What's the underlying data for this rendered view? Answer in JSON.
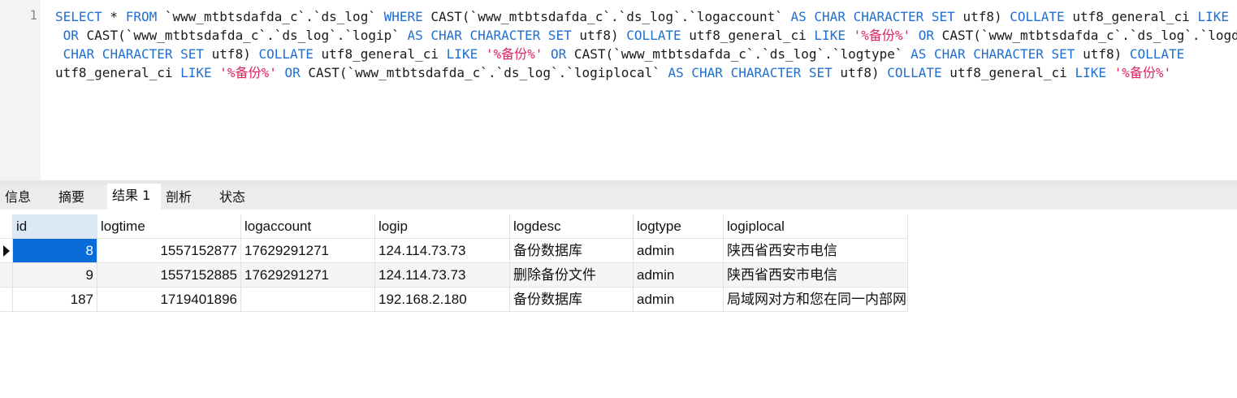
{
  "editor": {
    "line_number": "1",
    "lines": [
      [
        [
          "SELECT",
          "kw"
        ],
        [
          " * ",
          ""
        ],
        [
          "FROM",
          "kw"
        ],
        [
          " `www_mtbtsdafda_c`.`ds_log` ",
          ""
        ],
        [
          "WHERE",
          "kw"
        ],
        [
          " CAST(`www_mtbtsdafda_c`.`ds_log`.`logaccount` ",
          ""
        ],
        [
          "AS CHAR CHARACTER SET",
          "kw"
        ],
        [
          " utf8) ",
          ""
        ],
        [
          "COLLATE",
          "kw"
        ],
        [
          " utf8_general_ci ",
          ""
        ],
        [
          "LIKE",
          "kw"
        ],
        [
          " ",
          ""
        ],
        [
          "'%备份%'",
          "str"
        ]
      ],
      [
        [
          " ",
          ""
        ],
        [
          "OR",
          "kw"
        ],
        [
          " CAST(`www_mtbtsdafda_c`.`ds_log`.`logip` ",
          ""
        ],
        [
          "AS CHAR CHARACTER SET",
          "kw"
        ],
        [
          " utf8) ",
          ""
        ],
        [
          "COLLATE",
          "kw"
        ],
        [
          " utf8_general_ci ",
          ""
        ],
        [
          "LIKE",
          "kw"
        ],
        [
          " ",
          ""
        ],
        [
          "'%备份%'",
          "str"
        ],
        [
          " ",
          ""
        ],
        [
          "OR",
          "kw"
        ],
        [
          " CAST(`www_mtbtsdafda_c`.`ds_log`.`logdesc` ",
          ""
        ],
        [
          "AS",
          "kw"
        ]
      ],
      [
        [
          " ",
          ""
        ],
        [
          "CHAR CHARACTER SET",
          "kw"
        ],
        [
          " utf8) ",
          ""
        ],
        [
          "COLLATE",
          "kw"
        ],
        [
          " utf8_general_ci ",
          ""
        ],
        [
          "LIKE",
          "kw"
        ],
        [
          " ",
          ""
        ],
        [
          "'%备份%'",
          "str"
        ],
        [
          " ",
          ""
        ],
        [
          "OR",
          "kw"
        ],
        [
          " CAST(`www_mtbtsdafda_c`.`ds_log`.`logtype` ",
          ""
        ],
        [
          "AS CHAR CHARACTER SET",
          "kw"
        ],
        [
          " utf8) ",
          ""
        ],
        [
          "COLLATE",
          "kw"
        ]
      ],
      [
        [
          "utf8_general_ci ",
          ""
        ],
        [
          "LIKE",
          "kw"
        ],
        [
          " ",
          ""
        ],
        [
          "'%备份%'",
          "str"
        ],
        [
          " ",
          ""
        ],
        [
          "OR",
          "kw"
        ],
        [
          " CAST(`www_mtbtsdafda_c`.`ds_log`.`logiplocal` ",
          ""
        ],
        [
          "AS CHAR CHARACTER SET",
          "kw"
        ],
        [
          " utf8) ",
          ""
        ],
        [
          "COLLATE",
          "kw"
        ],
        [
          " utf8_general_ci ",
          ""
        ],
        [
          "LIKE",
          "kw"
        ],
        [
          " ",
          ""
        ],
        [
          "'%备份%'",
          "str"
        ]
      ]
    ]
  },
  "tabs": [
    {
      "label": "信息",
      "active": false
    },
    {
      "label": "摘要",
      "active": false
    },
    {
      "label": "结果 1",
      "active": true
    },
    {
      "label": "剖析",
      "active": false
    },
    {
      "label": "状态",
      "active": false
    }
  ],
  "grid": {
    "columns": [
      {
        "label": "id",
        "align": "num"
      },
      {
        "label": "logtime",
        "align": "num"
      },
      {
        "label": "logaccount",
        "align": "text"
      },
      {
        "label": "logip",
        "align": "text"
      },
      {
        "label": "logdesc",
        "align": "text"
      },
      {
        "label": "logtype",
        "align": "text"
      },
      {
        "label": "logiplocal",
        "align": "text"
      }
    ],
    "rows": [
      [
        "8",
        "1557152877",
        "17629291271",
        "124.114.73.73",
        "备份数据库",
        "admin",
        "陕西省西安市电信"
      ],
      [
        "9",
        "1557152885",
        "17629291271",
        "124.114.73.73",
        "删除备份文件",
        "admin",
        "陕西省西安市电信"
      ],
      [
        "187",
        "1719401896",
        "",
        "192.168.2.180",
        "备份数据库",
        "admin",
        "局域网对方和您在同一内部网"
      ]
    ],
    "selected_row": 0,
    "selected_col": 0
  }
}
